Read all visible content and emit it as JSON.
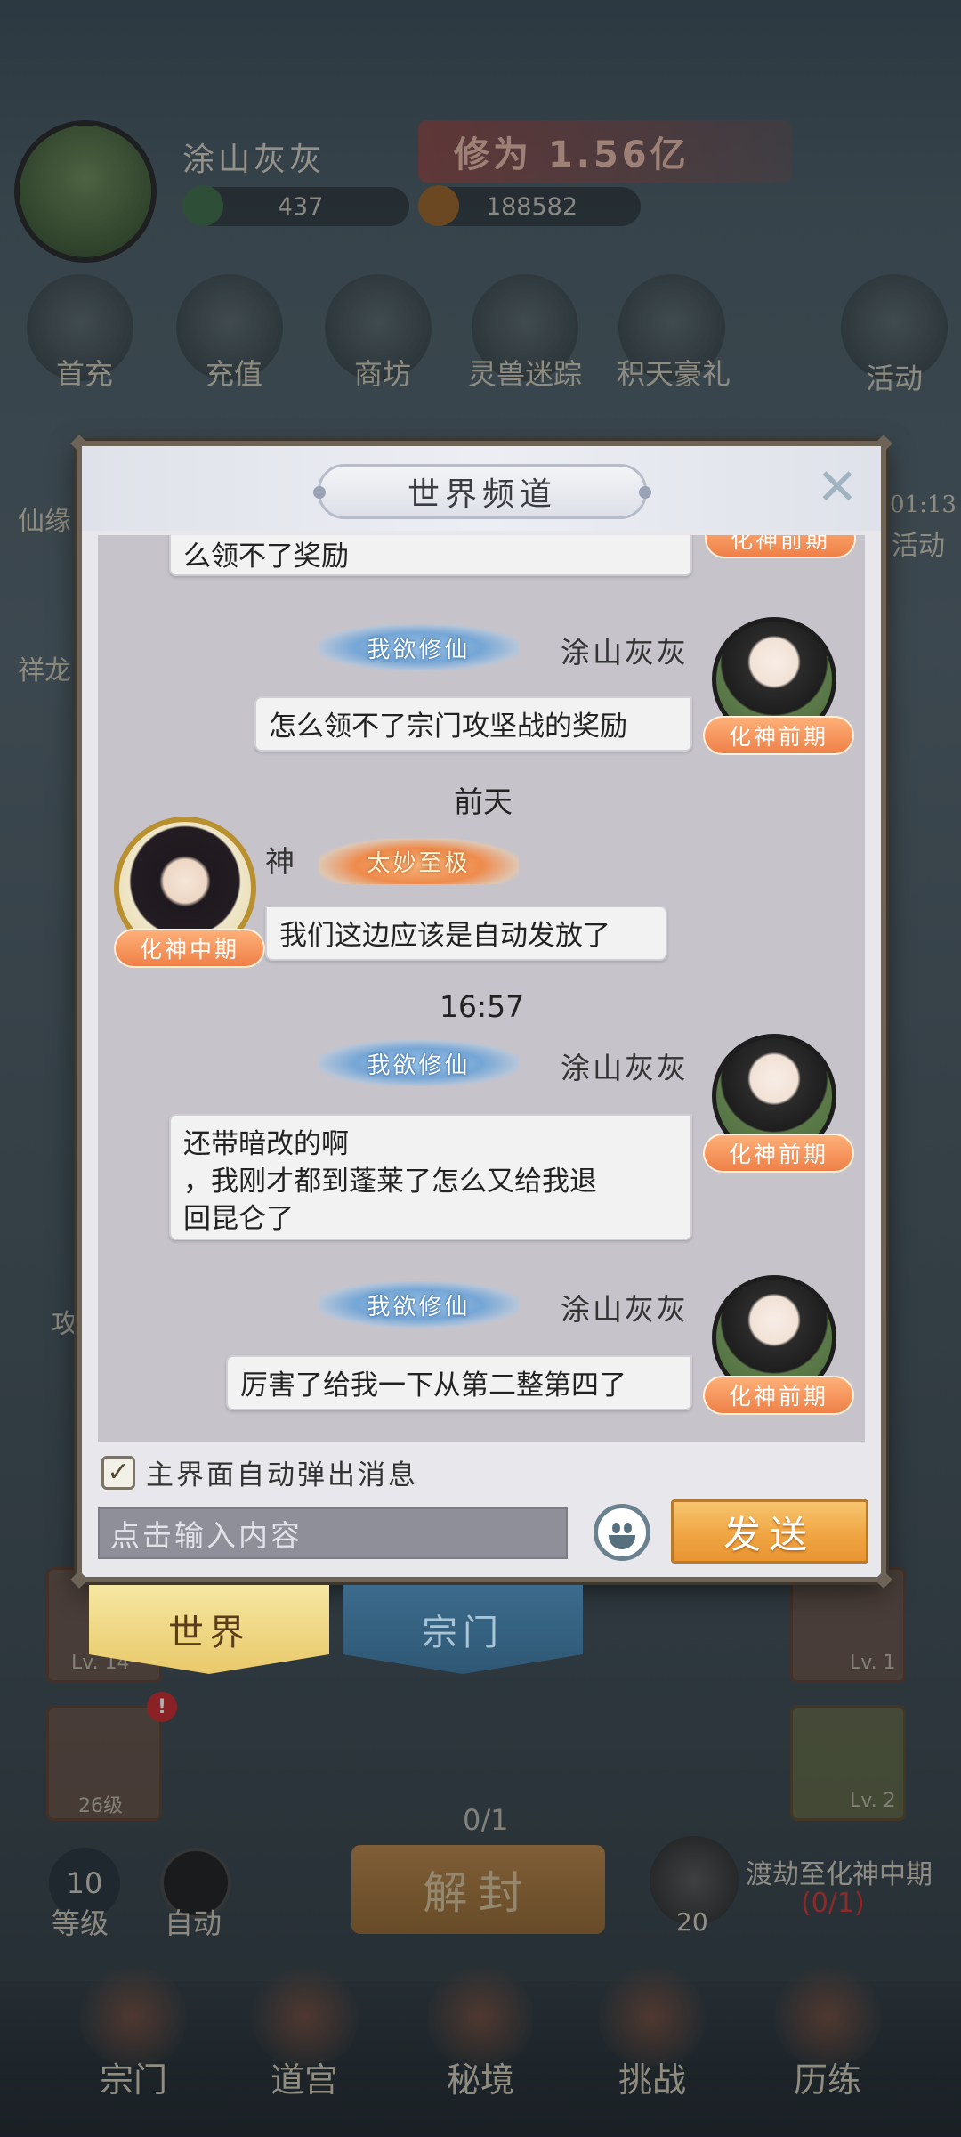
{
  "hud": {
    "player_name": "涂山灰灰",
    "cultivation": "修为 1.56亿",
    "jade": "437",
    "gold": "188582",
    "top_icons": [
      "首充",
      "充值",
      "商坊",
      "灵兽迷踪",
      "积天豪礼",
      "活动"
    ],
    "side_labels": [
      "仙缘",
      "祥龙",
      "攻"
    ],
    "timer": "01:13",
    "activity": "活动"
  },
  "chat": {
    "title": "世界频道",
    "messages": [
      {
        "partial_text": "么领不了奖励",
        "rank": "化神前期"
      },
      {
        "sender": "涂山灰灰",
        "title_badge": "我欲修仙",
        "text": "怎么领不了宗门攻坚战的奖励",
        "rank": "化神前期"
      },
      {
        "time": "前天"
      },
      {
        "sender": "神",
        "title_badge": "太妙至极",
        "text": "我们这边应该是自动发放了",
        "rank": "化神中期"
      },
      {
        "time": "16:57"
      },
      {
        "sender": "涂山灰灰",
        "title_badge": "我欲修仙",
        "text_lines": [
          "还带暗改的啊",
          "，我刚才都到蓬莱了怎么又给我退",
          "回昆仑了"
        ],
        "rank": "化神前期"
      },
      {
        "sender": "涂山灰灰",
        "title_badge": "我欲修仙",
        "text": "厉害了给我一下从第二整第四了",
        "rank": "化神前期"
      }
    ],
    "auto_popup_label": "主界面自动弹出消息",
    "auto_popup_checked": true,
    "input_placeholder": "点击输入内容",
    "send_label": "发送"
  },
  "tabs": {
    "world": "世界",
    "sect": "宗门"
  },
  "bottom": {
    "progress": "0/1",
    "unseal": "解封",
    "level_value": "10",
    "level_label": "等级",
    "auto_label": "自动",
    "tribulation": "渡劫至化神中期",
    "tribulation_count": "(0/1)",
    "trib_number": "20",
    "tile_lv1": "Lv. 14",
    "tile_lv2": "Lv. 1",
    "tile_lv3": "Lv. 2",
    "tile_lv4": "26级",
    "alert": "!",
    "nav": [
      "宗门",
      "道宫",
      "秘境",
      "挑战",
      "历练"
    ]
  }
}
